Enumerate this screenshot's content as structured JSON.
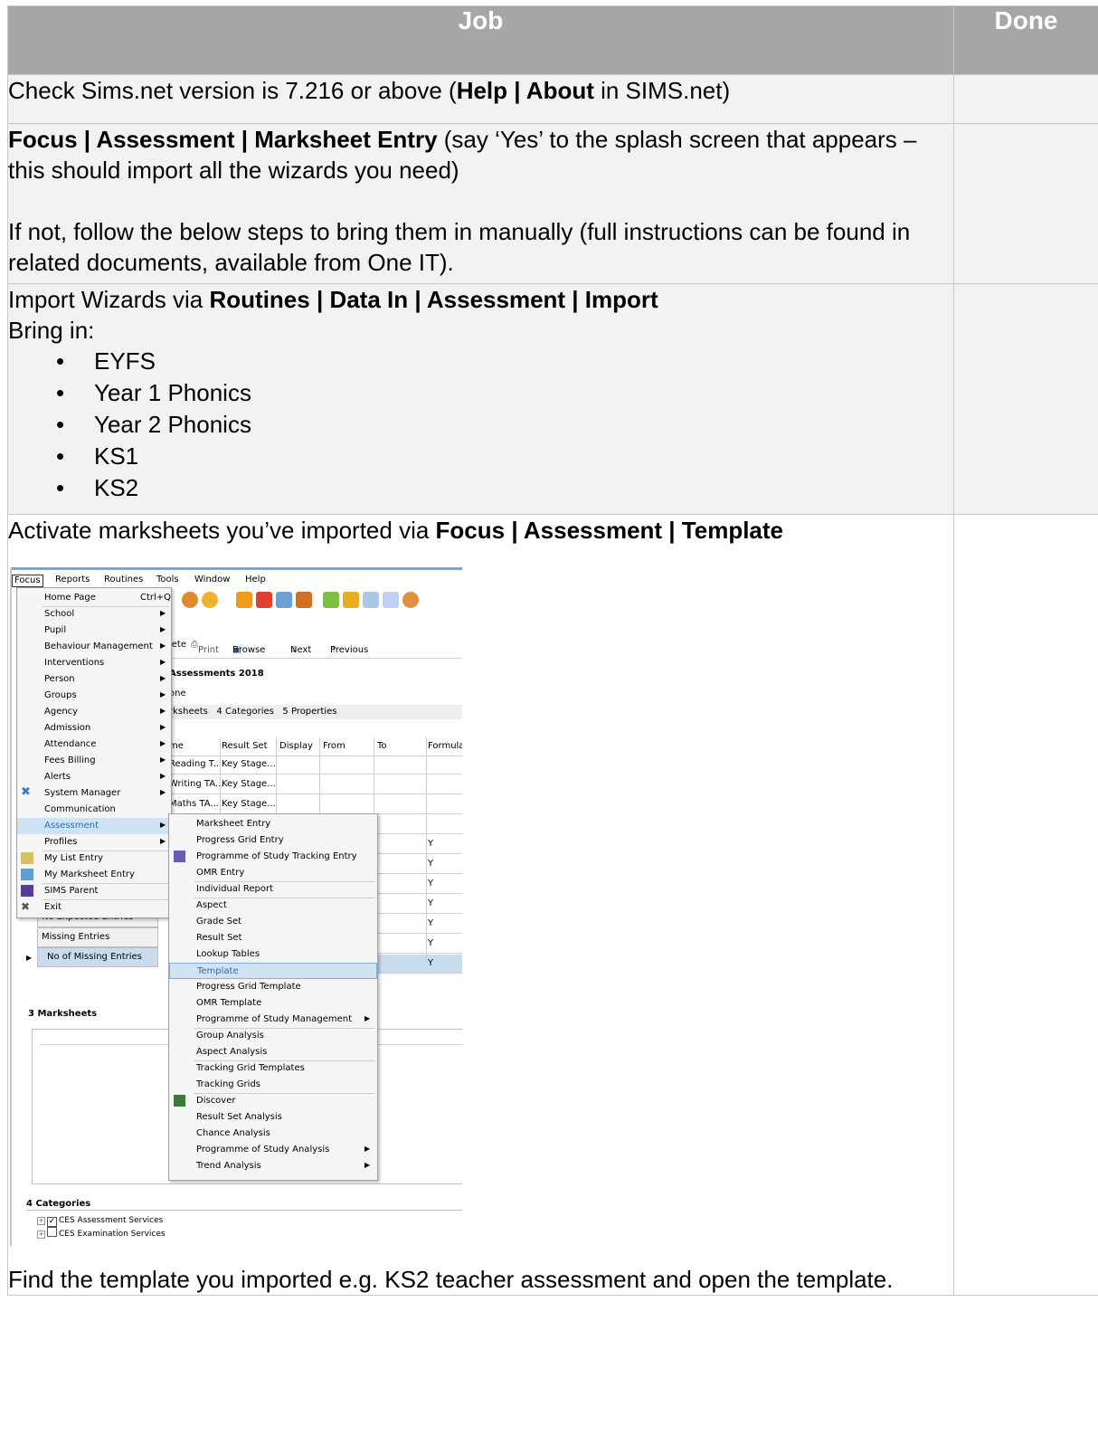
{
  "header": {
    "job": "Job",
    "done": "Done"
  },
  "row1": {
    "pre": "Check Sims.net version is 7.216 or above (",
    "bold": "Help | About",
    "post": " in SIMS.net)"
  },
  "row2": {
    "bold": "Focus | Assessment | Marksheet Entry",
    "post": " (say ‘Yes’ to the splash screen that appears – this should import all the wizards you need)",
    "para2": "If not, follow the below steps to bring them in manually (full instructions can be found in related documents, available from One IT)."
  },
  "row3": {
    "pre": "Import Wizards via ",
    "bold": "Routines | Data In | Assessment | Import",
    "line2": "Bring in:",
    "items": [
      "EYFS",
      "Year 1 Phonics",
      "Year 2 Phonics",
      "KS1",
      "KS2"
    ]
  },
  "row4": {
    "pre": "Activate marksheets you’ve imported via ",
    "bold": "Focus | Assessment | Template",
    "para2": "Find the template you imported e.g. KS2 teacher assessment and open the template."
  },
  "screenshot": {
    "menubar": [
      "Focus",
      "Reports",
      "Routines",
      "Tools",
      "Window",
      "Help"
    ],
    "buttons": [
      "lete",
      "Print",
      "Browse",
      "Next",
      "Previous"
    ],
    "title": "Assessments 2018",
    "subtitle": "one",
    "tabs": "rksheets   4 Categories   5 Properties",
    "grid_headers": [
      "me",
      "Result Set",
      "Display",
      "From",
      "To",
      "Formula"
    ],
    "grid_rows": [
      [
        "Reading T...",
        "Key Stage..."
      ],
      [
        "Writing TA...",
        "Key Stage..."
      ],
      [
        "Maths TA...",
        "Key Stage..."
      ]
    ],
    "formula_y": [
      "Y",
      "Y",
      "Y",
      "Y",
      "Y",
      "Y",
      "Y"
    ],
    "left_rows": [
      "No Expected Entries",
      "Missing Entries",
      "No of Missing Entries"
    ],
    "focus_menu": [
      {
        "label": "Home Page",
        "shortcut": "Ctrl+Q"
      },
      {
        "label": "School"
      },
      {
        "label": "Pupil"
      },
      {
        "label": "Behaviour Management"
      },
      {
        "label": "Interventions"
      },
      {
        "label": "Person"
      },
      {
        "label": "Groups"
      },
      {
        "label": "Agency"
      },
      {
        "label": "Admission"
      },
      {
        "label": "Attendance"
      },
      {
        "label": "Fees Billing"
      },
      {
        "label": "Alerts"
      },
      {
        "label": "System Manager"
      },
      {
        "label": "Communication"
      },
      {
        "label": "Assessment"
      },
      {
        "label": "Profiles"
      },
      {
        "label": "My List Entry"
      },
      {
        "label": "My Marksheet Entry"
      },
      {
        "label": "SIMS Parent"
      },
      {
        "label": "Exit"
      }
    ],
    "assessment_menu": [
      "Marksheet Entry",
      "Progress Grid Entry",
      "Programme of Study Tracking Entry",
      "OMR Entry",
      "Individual Report",
      "Aspect",
      "Grade Set",
      "Result Set",
      "Lookup Tables",
      "Template",
      "Progress Grid Template",
      "OMR Template",
      "Programme of Study Management",
      "Group Analysis",
      "Aspect Analysis",
      "Tracking Grid Templates",
      "Tracking Grids",
      "Discover",
      "Result Set Analysis",
      "Chance Analysis",
      "Programme of Study Analysis",
      "Trend Analysis"
    ],
    "section3": "3 Marksheets",
    "section4": "4 Categories",
    "categories": [
      "CES Assessment Services",
      "CES Examination Services"
    ]
  }
}
